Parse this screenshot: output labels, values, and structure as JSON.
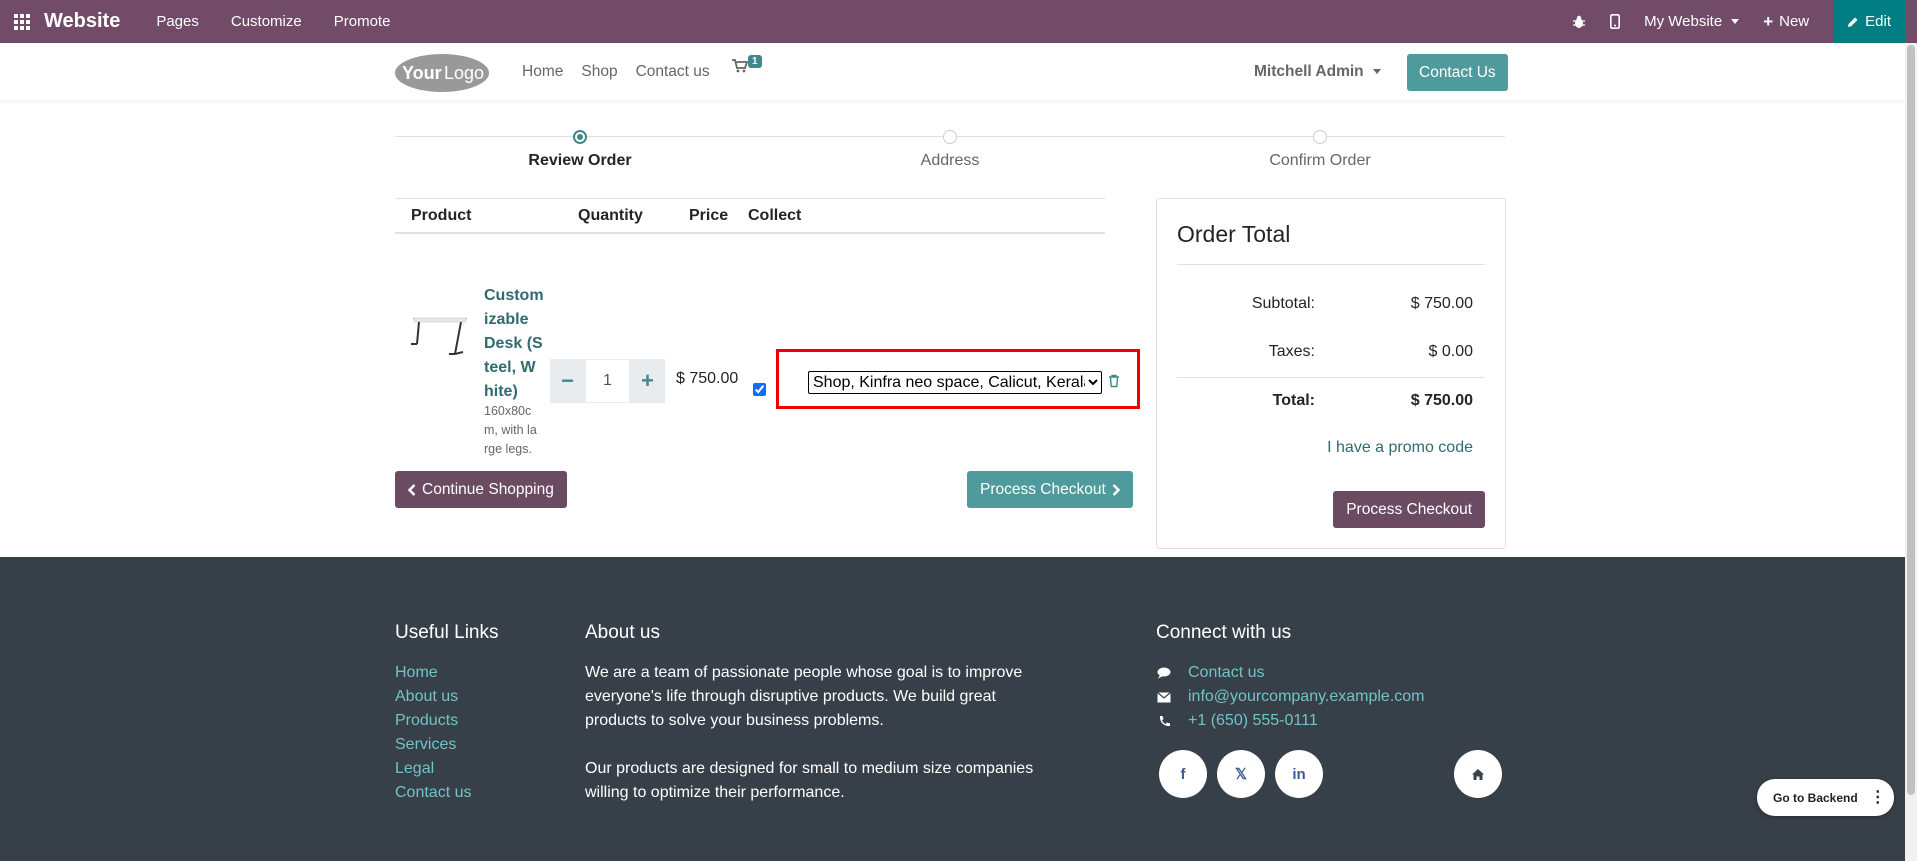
{
  "admin_bar": {
    "brand": "Website",
    "menu": [
      "Pages",
      "Customize",
      "Promote"
    ],
    "website_selector": "My Website",
    "new_label": "New",
    "edit_label": "Edit"
  },
  "header": {
    "logo_text": "YourLogo",
    "nav": [
      "Home",
      "Shop",
      "Contact us"
    ],
    "cart_count": "1",
    "user": "Mitchell Admin",
    "contact_button": "Contact Us"
  },
  "steps": [
    {
      "label": "Review Order",
      "active": true
    },
    {
      "label": "Address",
      "active": false
    },
    {
      "label": "Confirm Order",
      "active": false
    }
  ],
  "cart": {
    "headers": {
      "product": "Product",
      "quantity": "Quantity",
      "price": "Price",
      "collect": "Collect"
    },
    "line": {
      "name": "Customizable Desk (Steel, White)",
      "description": "160x80cm, with large legs.",
      "quantity": "1",
      "price": "$ 750.00",
      "collect_checked": true,
      "collect_location": "Shop, Kinfra neo space, Calicut, Kerala"
    },
    "continue_label": "Continue Shopping",
    "process_label": "Process Checkout"
  },
  "order_total": {
    "title": "Order Total",
    "subtotal_label": "Subtotal:",
    "subtotal": "$ 750.00",
    "taxes_label": "Taxes:",
    "taxes": "$ 0.00",
    "total_label": "Total:",
    "total": "$ 750.00",
    "promo_label": "I have a promo code",
    "process_label": "Process Checkout"
  },
  "footer": {
    "useful_links_title": "Useful Links",
    "useful_links": [
      "Home",
      "About us",
      "Products",
      "Services",
      "Legal",
      "Contact us"
    ],
    "about_title": "About us",
    "about_p1": "We are a team of passionate people whose goal is to improve everyone's life through disruptive products. We build great products to solve your business problems.",
    "about_p2": "Our products are designed for small to medium size companies willing to optimize their performance.",
    "connect_title": "Connect with us",
    "contact_link": "Contact us",
    "email": "info@yourcompany.example.com",
    "phone": "+1 (650) 555-0111",
    "social_facebook": "f",
    "social_x": "𝕏",
    "social_linkedin": "in"
  },
  "backend_button": "Go to Backend",
  "colors": {
    "admin_bar": "#714B67",
    "edit_button": "#017E84",
    "primary": "#4e9a9c",
    "secondary": "#6b4b62",
    "footer": "#373f48",
    "highlight_border": "#e00000"
  }
}
